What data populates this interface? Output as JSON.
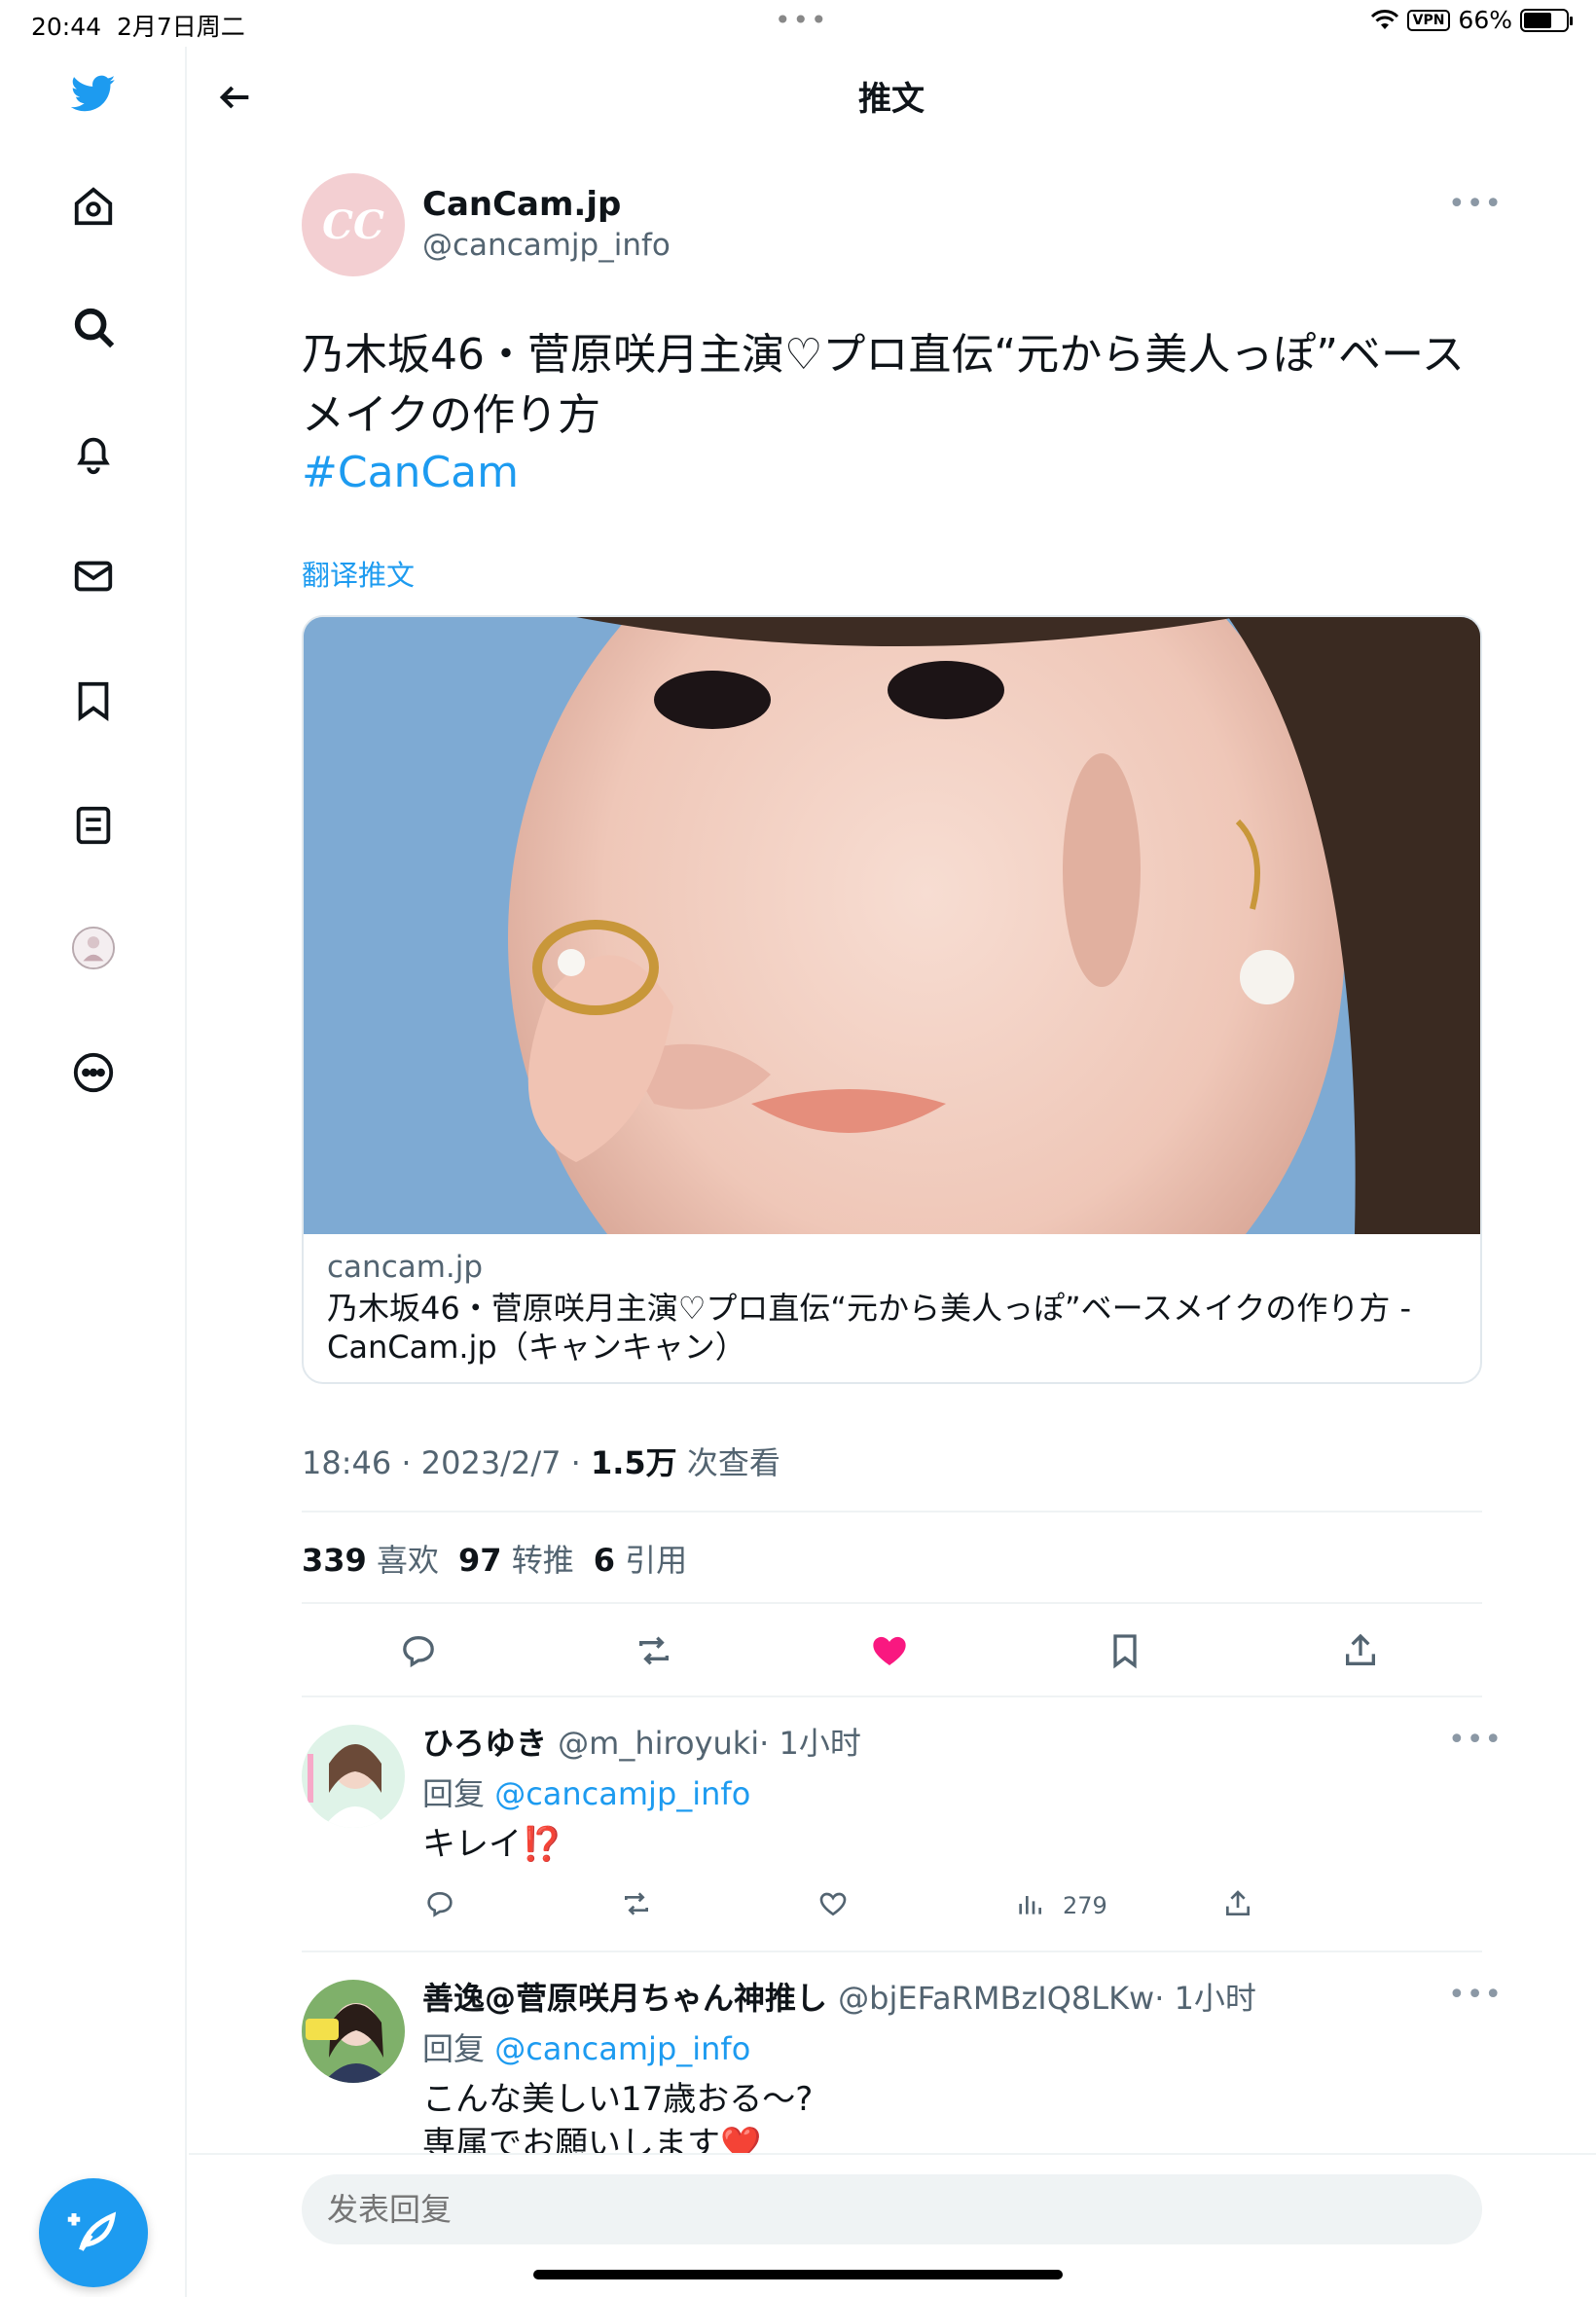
{
  "status_bar": {
    "time": "20:44",
    "date": "2月7日周二",
    "dots": "•••",
    "vpn": "VPN",
    "battery": "66%",
    "battery_level": 0.66
  },
  "sidebar": {
    "items": [
      "twitter-logo",
      "home",
      "explore",
      "notifications",
      "messages",
      "bookmarks",
      "lists",
      "profile",
      "more"
    ]
  },
  "header": {
    "title": "推文"
  },
  "tweet": {
    "author_name": "CanCam.jp",
    "author_handle": "@cancamjp_info",
    "avatar_text": "CC",
    "text": "乃木坂46・菅原咲月主演♡プロ直伝“元から美人っぽ”ベースメイクの作り方",
    "hashtag": "#CanCam",
    "translate_label": "翻译推文",
    "card": {
      "domain": "cancam.jp",
      "title": "乃木坂46・菅原咲月主演♡プロ直伝“元から美人っぽ”ベースメイクの作り方 - CanCam.jp（キャンキャン）"
    },
    "time": "18:46",
    "date": "2023/2/7",
    "views": "1.5万",
    "views_label": "次查看",
    "likes": "339",
    "likes_label": "喜欢",
    "retweets": "97",
    "retweets_label": "转推",
    "quotes": "6",
    "quotes_label": "引用"
  },
  "replies": [
    {
      "name": "ひろゆき",
      "handle": "@m_hiroyuki",
      "time": "· 1小时",
      "reply_prefix": "回复",
      "reply_to": "@cancamjp_info",
      "text": "キレイ⁉️",
      "views": "279"
    },
    {
      "name": "善逸@菅原咲月ちゃん神推し",
      "handle": "@bjEFaRMBzIQ8LKw",
      "time": "· 1小时",
      "reply_prefix": "回复",
      "reply_to": "@cancamjp_info",
      "text_line1": "こんな美しい17歳おる～?",
      "text_line2": "専属でお願いします❤️"
    }
  ],
  "reply_bar": {
    "placeholder": "发表回复"
  },
  "colors": {
    "accent": "#1d9bf0",
    "like": "#f91880",
    "text": "#0f1419",
    "muted": "#536471"
  }
}
